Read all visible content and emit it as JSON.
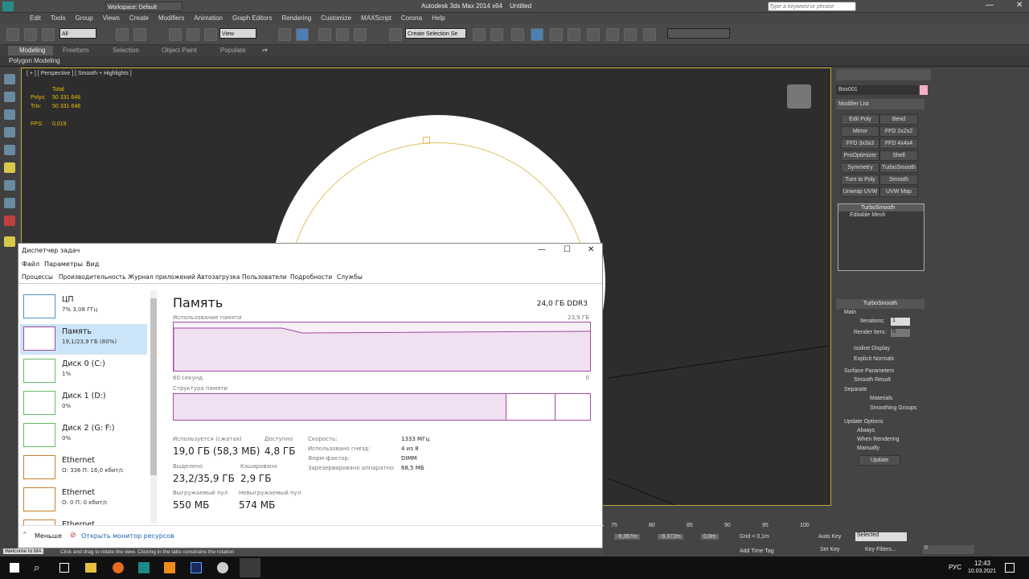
{
  "max": {
    "title": "Autodesk 3ds Max  2014 x64",
    "file": "Untitled",
    "workspace": "Workspace: Default",
    "search_placeholder": "Type a keyword or phrase",
    "menu": [
      "Edit",
      "Tools",
      "Group",
      "Views",
      "Create",
      "Modifiers",
      "Animation",
      "Graph Editors",
      "Rendering",
      "Customize",
      "MAXScript",
      "Corona",
      "Help"
    ],
    "toolbar": {
      "filter": "All",
      "view": "View",
      "selection_set": "Create Selection Se"
    },
    "ribbon": [
      "Modeling",
      "Freeform",
      "Selection",
      "Object Paint",
      "Populate"
    ],
    "ribbon_sub": "Polygon Modeling",
    "viewport": {
      "label": "[ + ] [ Perspective ] [ Smooth + Highlights ]",
      "total": "Total",
      "polys_label": "Polys:",
      "polys": "50 331 648",
      "tris_label": "Tris:",
      "tris": "50 331 648",
      "fps_label": "FPS:",
      "fps": "0,019"
    },
    "command": {
      "object_name": "Box001",
      "modifier_list": "Modifier List",
      "buttons": [
        "Edit Poly",
        "Bend",
        "Mirror",
        "FFD 2x2x2",
        "FFD 3x3x3",
        "FFD 4x4x4",
        "ProOptimizer",
        "Shell",
        "Symmetry",
        "TurboSmooth",
        "Turn to Poly",
        "Smooth",
        "Unwrap UVW",
        "UVW Map"
      ],
      "stack": [
        "TurboSmooth",
        "Editable Mesh"
      ],
      "rollout": "TurboSmooth",
      "main": "Main",
      "iterations_label": "Iterations:",
      "iterations": "1",
      "render_iters": "Render Iters:",
      "render_iters_val": "0",
      "isoline": "Isoline Display",
      "explicit": "Explicit Normals",
      "surface": "Surface Parameters",
      "smooth_result": "Smooth Result",
      "separate": "Separate",
      "materials": "Materials",
      "smoothing_groups": "Smoothing Groups",
      "update_options": "Update Options",
      "always": "Always",
      "when_rendering": "When Rendering",
      "manually": "Manually",
      "update": "Update"
    },
    "status": {
      "prompt": "Click and drag to rotate the view.  Clicking in the tabs constrains the rotation",
      "welcome": "Welcome to MA",
      "x": "-9,397m",
      "y": "-9,372m",
      "z": "0,0m",
      "grid": "Grid = 0,1m",
      "auto_key": "Auto Key",
      "selected": "Selected",
      "set_key": "Set Key",
      "key_filters": "Key Filters...",
      "add_time_tag": "Add Time Tag",
      "frame": "0",
      "ticks": [
        "75",
        "80",
        "85",
        "90",
        "95",
        "100"
      ]
    }
  },
  "tm": {
    "title": "Диспетчер задач",
    "menu": [
      "Файл",
      "Параметры",
      "Вид"
    ],
    "tabs": [
      "Процессы",
      "Производительность",
      "Журнал приложений",
      "Автозагрузка",
      "Пользователи",
      "Подробности",
      "Службы"
    ],
    "side": [
      {
        "name": "ЦП",
        "value": "7% 3,08 ГГц"
      },
      {
        "name": "Память",
        "value": "19,1/23,9 ГБ (80%)"
      },
      {
        "name": "Диск 0 (C:)",
        "value": "1%"
      },
      {
        "name": "Диск 1 (D:)",
        "value": "0%"
      },
      {
        "name": "Диск 2 (G: F:)",
        "value": "0%"
      },
      {
        "name": "Ethernet",
        "value": "О: 336 П: 16,0 кбит/с"
      },
      {
        "name": "Ethernet",
        "value": "О: 0 П: 0 кбит/с"
      },
      {
        "name": "Ethernet",
        "value": ""
      }
    ],
    "heading": "Память",
    "capacity": "24,0 ГБ DDR3",
    "usage_label": "Использование памяти",
    "usage_max": "23,9 ГБ",
    "seconds": "60 секунд",
    "zero": "0",
    "structure": "Структура памяти",
    "in_use_label": "Используется (сжатая)",
    "in_use": "19,0 ГБ (58,3 МБ)",
    "available_label": "Доступно",
    "available": "4,8 ГБ",
    "committed_label": "Выделено",
    "committed": "23,2/35,9 ГБ",
    "cached_label": "Кэшировано",
    "cached": "2,9 ГБ",
    "paged_label": "Выгружаемый пул",
    "paged": "550 МБ",
    "nonpaged_label": "Невыгружаемый пул",
    "nonpaged": "574 МБ",
    "speed_label": "Скорость:",
    "speed": "1333 МГц",
    "slots_label": "Использовано гнезд:",
    "slots": "4 из 8",
    "form_label": "Форм-фактор:",
    "form": "DIMM",
    "reserved_label": "Зарезервировано аппаратно:",
    "reserved": "68,5 МБ",
    "less": "Меньше",
    "monitor": "Открыть монитор ресурсов"
  },
  "taskbar": {
    "time": "12:43",
    "date": "10.03.2021",
    "lang": "РУС"
  }
}
